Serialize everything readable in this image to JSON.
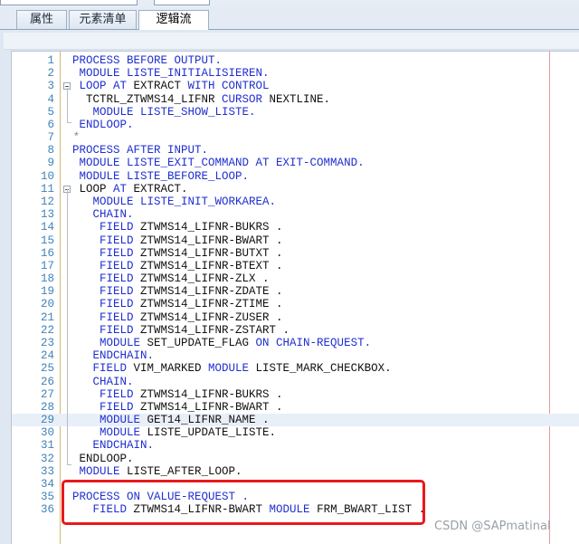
{
  "tabs": [
    {
      "label": "属性",
      "active": false
    },
    {
      "label": "元素清单",
      "active": false
    },
    {
      "label": "逻辑流",
      "active": true
    }
  ],
  "code_lines": [
    {
      "n": "1",
      "t": [
        [
          "PROCESS BEFORE OUTPUT.",
          "kw"
        ]
      ]
    },
    {
      "n": "2",
      "t": [
        [
          " MODULE LISTE_INITIALISIEREN.",
          "kw"
        ]
      ]
    },
    {
      "n": "3",
      "t": [
        [
          " LOOP AT ",
          "kw"
        ],
        [
          "EXTRACT ",
          ""
        ],
        [
          "WITH CONTROL",
          "kw"
        ]
      ]
    },
    {
      "n": "4",
      "t": [
        [
          "  TCTRL_ZTWMS14_LIFNR ",
          ""
        ],
        [
          "CURSOR ",
          "kw"
        ],
        [
          "NEXTLINE.",
          ""
        ]
      ]
    },
    {
      "n": "5",
      "t": [
        [
          "   MODULE LISTE_SHOW_LISTE.",
          "kw"
        ]
      ]
    },
    {
      "n": "6",
      "t": [
        [
          " ENDLOOP.",
          "kw"
        ]
      ]
    },
    {
      "n": "7",
      "t": [
        [
          "*",
          "cm"
        ]
      ]
    },
    {
      "n": "8",
      "t": [
        [
          "PROCESS AFTER INPUT.",
          "kw"
        ]
      ]
    },
    {
      "n": "9",
      "t": [
        [
          " MODULE LISTE_EXIT_COMMAND ",
          "kw"
        ],
        [
          "AT EXIT-COMMAND.",
          "kw"
        ]
      ]
    },
    {
      "n": "10",
      "t": [
        [
          " MODULE LISTE_BEFORE_LOOP.",
          "kw"
        ]
      ]
    },
    {
      "n": "11",
      "t": [
        [
          " LOOP ",
          ""
        ],
        [
          "AT ",
          "kw"
        ],
        [
          "EXTRACT.",
          ""
        ]
      ]
    },
    {
      "n": "12",
      "t": [
        [
          "   MODULE LISTE_INIT_WORKAREA.",
          "kw"
        ]
      ]
    },
    {
      "n": "13",
      "t": [
        [
          "   CHAIN.",
          "kw"
        ]
      ]
    },
    {
      "n": "14",
      "t": [
        [
          "    FIELD ",
          "kw"
        ],
        [
          "ZTWMS14_LIFNR-BUKRS .",
          ""
        ]
      ]
    },
    {
      "n": "15",
      "t": [
        [
          "    FIELD ",
          "kw"
        ],
        [
          "ZTWMS14_LIFNR-BWART .",
          ""
        ]
      ]
    },
    {
      "n": "16",
      "t": [
        [
          "    FIELD ",
          "kw"
        ],
        [
          "ZTWMS14_LIFNR-BUTXT .",
          ""
        ]
      ]
    },
    {
      "n": "17",
      "t": [
        [
          "    FIELD ",
          "kw"
        ],
        [
          "ZTWMS14_LIFNR-BTEXT .",
          ""
        ]
      ]
    },
    {
      "n": "18",
      "t": [
        [
          "    FIELD ",
          "kw"
        ],
        [
          "ZTWMS14_LIFNR-ZLX .",
          ""
        ]
      ]
    },
    {
      "n": "19",
      "t": [
        [
          "    FIELD ",
          "kw"
        ],
        [
          "ZTWMS14_LIFNR-ZDATE .",
          ""
        ]
      ]
    },
    {
      "n": "20",
      "t": [
        [
          "    FIELD ",
          "kw"
        ],
        [
          "ZTWMS14_LIFNR-ZTIME .",
          ""
        ]
      ]
    },
    {
      "n": "21",
      "t": [
        [
          "    FIELD ",
          "kw"
        ],
        [
          "ZTWMS14_LIFNR-ZUSER .",
          ""
        ]
      ]
    },
    {
      "n": "22",
      "t": [
        [
          "    FIELD ",
          "kw"
        ],
        [
          "ZTWMS14_LIFNR-ZSTART .",
          ""
        ]
      ]
    },
    {
      "n": "23",
      "t": [
        [
          "    MODULE ",
          "kw"
        ],
        [
          "SET_UPDATE_FLAG ",
          ""
        ],
        [
          "ON CHAIN-REQUEST.",
          "kw"
        ]
      ]
    },
    {
      "n": "24",
      "t": [
        [
          "   ENDCHAIN.",
          "kw"
        ]
      ]
    },
    {
      "n": "25",
      "t": [
        [
          "   FIELD ",
          "kw"
        ],
        [
          "VIM_MARKED ",
          ""
        ],
        [
          "MODULE ",
          "kw"
        ],
        [
          "LISTE_MARK_CHECKBOX.",
          ""
        ]
      ]
    },
    {
      "n": "26",
      "t": [
        [
          "   CHAIN.",
          "kw"
        ]
      ]
    },
    {
      "n": "27",
      "t": [
        [
          "    FIELD ",
          "kw"
        ],
        [
          "ZTWMS14_LIFNR-BUKRS .",
          ""
        ]
      ]
    },
    {
      "n": "28",
      "t": [
        [
          "    FIELD ",
          "kw"
        ],
        [
          "ZTWMS14_LIFNR-BWART .",
          ""
        ]
      ]
    },
    {
      "n": "29",
      "t": [
        [
          "    MODULE ",
          "kw"
        ],
        [
          "GET14_LIFNR_NAME .",
          ""
        ]
      ],
      "highlight": true
    },
    {
      "n": "30",
      "t": [
        [
          "    MODULE ",
          "kw"
        ],
        [
          "LISTE_UPDATE_LISTE.",
          ""
        ]
      ]
    },
    {
      "n": "31",
      "t": [
        [
          "   ENDCHAIN.",
          "kw"
        ]
      ]
    },
    {
      "n": "32",
      "t": [
        [
          " ENDLOOP.",
          ""
        ]
      ]
    },
    {
      "n": "33",
      "t": [
        [
          " MODULE ",
          "kw"
        ],
        [
          "LISTE_AFTER_LOOP.",
          ""
        ]
      ]
    },
    {
      "n": "34",
      "t": [
        [
          "",
          ""
        ]
      ]
    },
    {
      "n": "35",
      "t": [
        [
          "PROCESS ON VALUE-REQUEST .",
          "kw"
        ]
      ]
    },
    {
      "n": "36",
      "t": [
        [
          "   FIELD ",
          "kw"
        ],
        [
          "ZTWMS14_LIFNR-BWART ",
          ""
        ],
        [
          "MODULE ",
          "kw"
        ],
        [
          "FRM_BWART_LIST .",
          ""
        ]
      ]
    }
  ],
  "watermark": "CSDN @SAPmatinal",
  "colors": {
    "keyword": "#1f2fd0",
    "line_number": "#3f83b8",
    "annotation_box": "#e8191c"
  }
}
